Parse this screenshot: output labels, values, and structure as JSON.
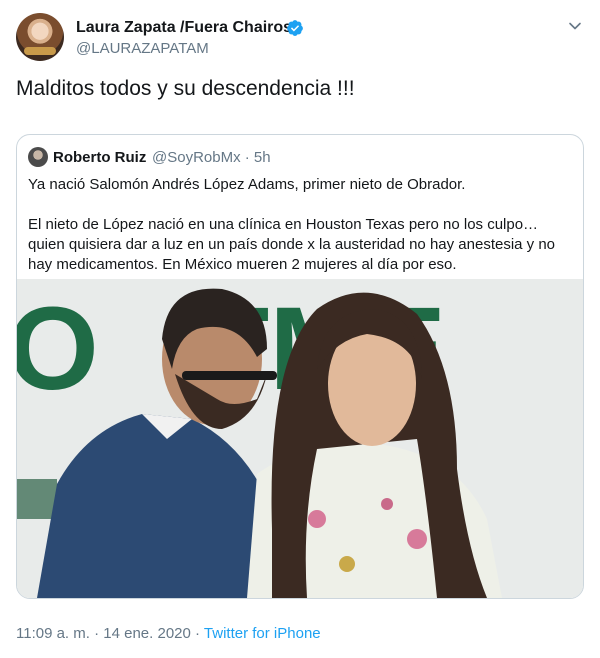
{
  "tweet": {
    "author_name": "Laura Zapata /Fuera Chairos",
    "author_handle": "@LAURAZAPATAM",
    "text": "Malditos todos y su descendencia !!!",
    "timestamp": "11:09 a. m. · 14 ene. 2020",
    "separator": " · ",
    "source": "Twitter for iPhone",
    "icons": {
      "verified": "verified-badge-icon",
      "menu": "chevron-down-icon"
    },
    "colors": {
      "link": "#1da1f2",
      "secondary_text": "#657786",
      "verified": "#1da1f2"
    }
  },
  "quoted": {
    "author_name": "Roberto Ruiz",
    "meta": "@SoyRobMx · 5h",
    "paragraph1": "Ya nació Salomón Andrés López Adams, primer nieto de Obrador.",
    "paragraph2": "El nieto de López nació en una clínica en Houston Texas pero no los culpo… quien quisiera dar a luz en un país donde x la austeridad no hay anestesia y no hay medicamentos. En México mueren 2 mujeres al día por eso.",
    "photo": {
      "background_letters": "O   TME"
    }
  }
}
